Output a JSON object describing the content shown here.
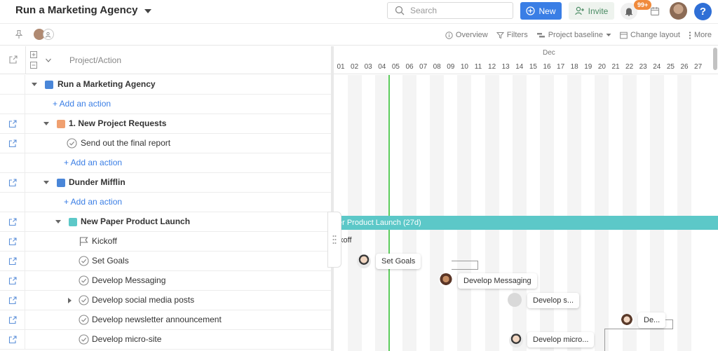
{
  "header": {
    "title": "Run a Marketing Agency",
    "search_placeholder": "Search",
    "new_label": "New",
    "invite_label": "Invite",
    "notif_badge": "99+",
    "help_label": "?"
  },
  "toolbar": {
    "overview": "Overview",
    "filters": "Filters",
    "baseline": "Project baseline",
    "layout": "Change layout",
    "more": "More"
  },
  "table": {
    "header": "Project/Action",
    "rows": [
      {
        "label": "Run a Marketing Agency",
        "kind": "project",
        "color": "#4a86d8"
      },
      {
        "label": "+ Add an action",
        "kind": "add"
      },
      {
        "label": "1. New Project Requests",
        "kind": "project",
        "color": "#f0a070"
      },
      {
        "label": "Send out the final report",
        "kind": "action"
      },
      {
        "label": "+ Add an action",
        "kind": "add"
      },
      {
        "label": "Dunder Mifflin",
        "kind": "project",
        "color": "#4a86d8"
      },
      {
        "label": "+ Add an action",
        "kind": "add"
      },
      {
        "label": "New Paper Product Launch",
        "kind": "project",
        "color": "#5cc8c8"
      },
      {
        "label": "Kickoff",
        "kind": "milestone"
      },
      {
        "label": "Set Goals",
        "kind": "action"
      },
      {
        "label": "Develop Messaging",
        "kind": "action"
      },
      {
        "label": "Develop social media posts",
        "kind": "action"
      },
      {
        "label": "Develop newsletter announcement",
        "kind": "action"
      },
      {
        "label": "Develop micro-site",
        "kind": "action"
      }
    ]
  },
  "gantt": {
    "month": "Dec",
    "days": [
      "01",
      "02",
      "03",
      "04",
      "05",
      "06",
      "07",
      "08",
      "09",
      "10",
      "11",
      "12",
      "13",
      "14",
      "15",
      "16",
      "17",
      "18",
      "19",
      "20",
      "21",
      "22",
      "23",
      "24",
      "25",
      "26",
      "27"
    ],
    "bar_label": "er Product Launch (27d)",
    "kickoff_label": "koff",
    "chips": [
      "Set Goals",
      "Develop Messaging",
      "Develop s...",
      "De...",
      "Develop micro..."
    ]
  }
}
